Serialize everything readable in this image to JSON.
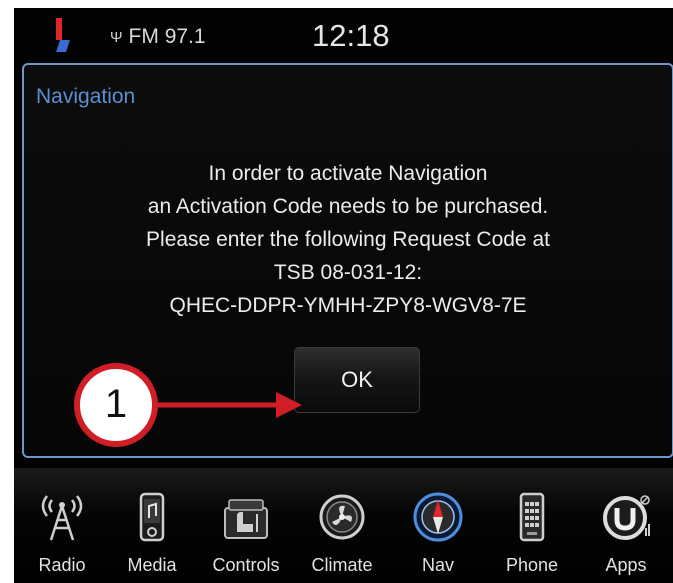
{
  "status_bar": {
    "station": "FM 97.1",
    "clock": "12:18",
    "signal_icon": "antenna-icon"
  },
  "dialog": {
    "title": "Navigation",
    "message_lines": [
      "In order to activate Navigation",
      "an Activation Code needs to be purchased.",
      "Please enter the following Request Code at",
      "TSB 08-031-12:",
      "QHEC-DDPR-YMHH-ZPY8-WGV8-7E"
    ],
    "ok_label": "OK"
  },
  "annotation": {
    "callout_number": "1"
  },
  "nav_bar": {
    "items": [
      {
        "label": "Radio",
        "icon": "radio-tower-icon"
      },
      {
        "label": "Media",
        "icon": "media-player-icon"
      },
      {
        "label": "Controls",
        "icon": "seat-controls-icon"
      },
      {
        "label": "Climate",
        "icon": "climate-fan-icon"
      },
      {
        "label": "Nav",
        "icon": "compass-icon",
        "active": true
      },
      {
        "label": "Phone",
        "icon": "phone-icon"
      },
      {
        "label": "Apps",
        "icon": "apps-icon"
      }
    ]
  },
  "colors": {
    "dialog_border": "#6d98c6",
    "title_blue": "#5b8fd0",
    "callout_red": "#d11d26",
    "flag_red": "#e0262a",
    "flag_blue": "#3a6bd3"
  }
}
